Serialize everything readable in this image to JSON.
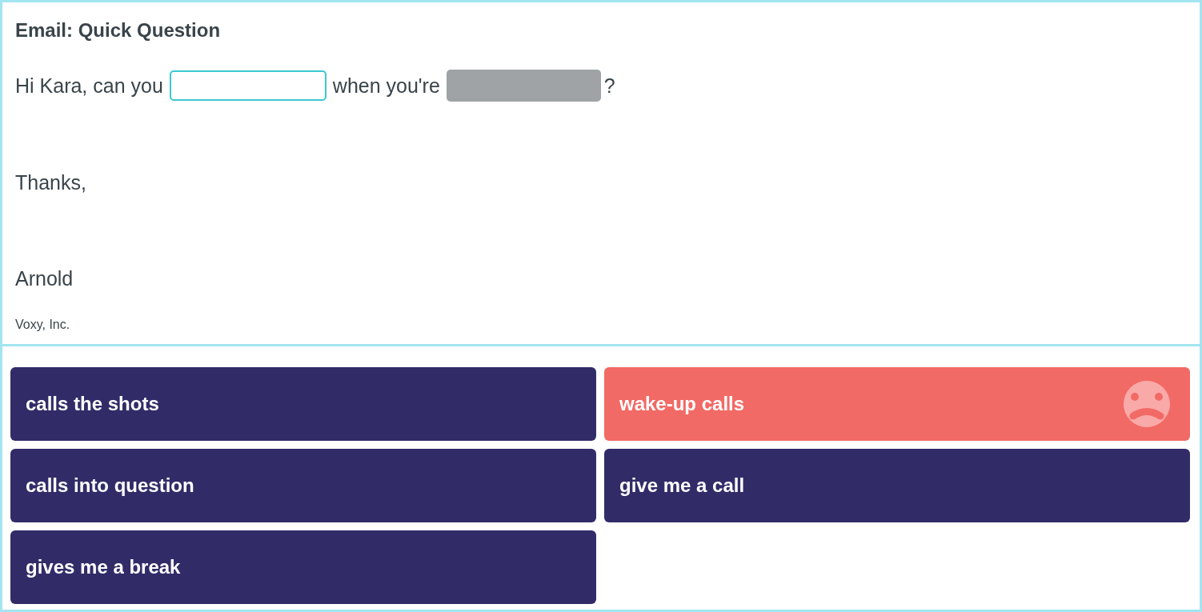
{
  "email": {
    "title": "Email: Quick Question",
    "sentence": [
      {
        "kind": "text",
        "text": "Hi Kara, can you"
      },
      {
        "kind": "blank",
        "active": true
      },
      {
        "kind": "text",
        "text": "when you're"
      },
      {
        "kind": "blank",
        "active": false
      },
      {
        "kind": "text",
        "text": "?"
      }
    ],
    "closing": "Thanks,",
    "signature": "Arnold",
    "company": "Voxy, Inc."
  },
  "options": [
    {
      "label": "calls the shots",
      "incorrect": false
    },
    {
      "label": "wake-up calls",
      "incorrect": true
    },
    {
      "label": "calls into question",
      "incorrect": false
    },
    {
      "label": "give me a call",
      "incorrect": false
    },
    {
      "label": "gives me a break",
      "incorrect": false
    }
  ]
}
